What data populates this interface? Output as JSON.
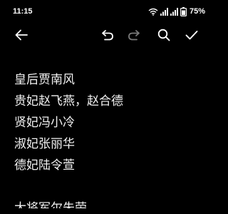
{
  "status_bar": {
    "time": "11:15",
    "battery_percent": "75%",
    "icons": [
      "wifi-icon",
      "signal-icon",
      "signal-icon",
      "battery-icon"
    ]
  },
  "toolbar": {
    "back_icon": "arrow-left-icon",
    "undo_icon": "undo-icon",
    "redo_icon": "redo-icon",
    "search_icon": "search-icon",
    "confirm_icon": "check-icon"
  },
  "note": {
    "lines": [
      "皇后贾南风",
      "贵妃赵飞燕，赵合德",
      "贤妃冯小冷",
      "淑妃张丽华",
      "德妃陆令萱",
      "",
      "大将军尔朱荣"
    ]
  },
  "colors": {
    "background": "#000000",
    "text": "#f2f2f2",
    "icon": "#ffffff",
    "disabled_icon": "#7a7a7a"
  }
}
